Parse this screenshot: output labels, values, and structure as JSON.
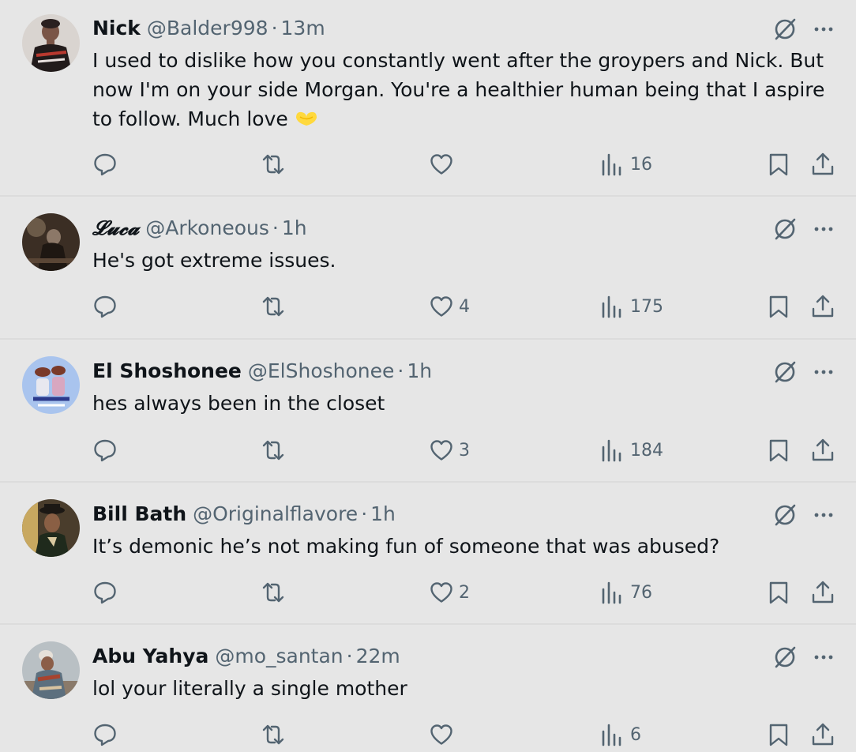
{
  "tweets": [
    {
      "name": "Nick",
      "handle": "@Balder998",
      "dot": "·",
      "time": "13m",
      "text": "I used to dislike how you constantly went after the groypers and Nick. But now I'm on your side Morgan. You're a healthier human being that I aspire to follow. Much love",
      "emoji": "heart-hands-emoji",
      "likes": "",
      "views": "16"
    },
    {
      "name": "𝓛𝓾𝓬𝓪",
      "handle": "@Arkoneous",
      "dot": "·",
      "time": "1h",
      "text": "He's got extreme issues.",
      "likes": "4",
      "views": "175"
    },
    {
      "name": "El Shoshonee",
      "handle": "@ElShoshonee",
      "dot": "·",
      "time": "1h",
      "text": "hes always been in the closet",
      "likes": "3",
      "views": "184"
    },
    {
      "name": "Bill Bath",
      "handle": "@Originalflavore",
      "dot": "·",
      "time": "1h",
      "text": "It’s demonic he’s not making fun of someone that was abused?",
      "likes": "2",
      "views": "76"
    },
    {
      "name": "Abu Yahya",
      "handle": "@mo_santan",
      "dot": "·",
      "time": "22m",
      "text": "lol your literally a single mother",
      "likes": "",
      "views": "6"
    }
  ],
  "icons": {
    "reply": "reply-icon",
    "retweet": "retweet-icon",
    "like": "heart-icon",
    "views": "views-icon",
    "bookmark": "bookmark-icon",
    "share": "share-icon",
    "grok": "grok-icon",
    "more": "more-icon"
  },
  "colors": {
    "background": "#e6e6e6",
    "text": "#0f1419",
    "secondary": "#536471",
    "divider": "#dcdcdc",
    "emoji": "#ffd93d"
  }
}
